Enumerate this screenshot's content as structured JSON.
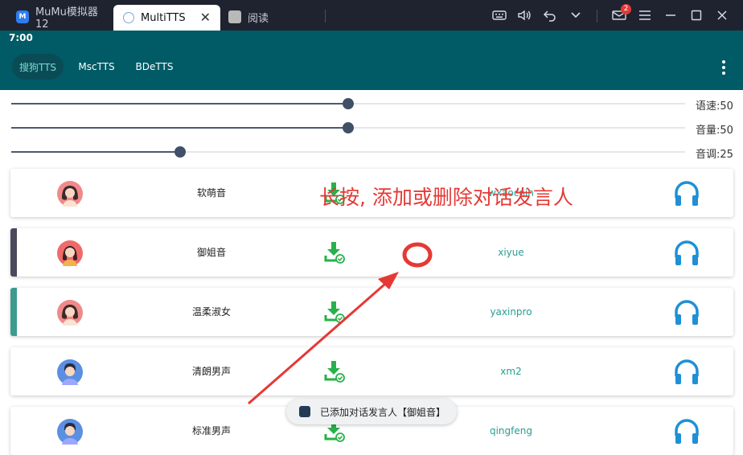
{
  "host": {
    "tabs": [
      {
        "label": "MuMu模拟器12",
        "icon": "mumu-logo-icon"
      },
      {
        "label": "MultiTTS",
        "icon": "multitts-icon"
      },
      {
        "label": "阅读",
        "icon": "reader-app-icon"
      }
    ],
    "mail_badge": "2",
    "controls": [
      "keyboard-icon",
      "volume-icon",
      "back-icon",
      "chevron-down-icon",
      "mail-icon",
      "menu-icon",
      "minimize-icon",
      "maximize-icon",
      "close-icon"
    ]
  },
  "status": {
    "time": "7:00"
  },
  "app": {
    "tabs": [
      "搜狗TTS",
      "MscTTS",
      "BDeTTS"
    ],
    "active_tab": 0
  },
  "sliders": [
    {
      "label": "语速:50",
      "value": 50,
      "max": 100
    },
    {
      "label": "音量:50",
      "value": 50,
      "max": 100
    },
    {
      "label": "音调:25",
      "value": 25,
      "max": 100
    }
  ],
  "voices": [
    {
      "name": "软萌音",
      "id": "wxaocnin",
      "gender": "female",
      "stripe": ""
    },
    {
      "name": "御姐音",
      "id": "xiyue",
      "gender": "female",
      "stripe": "#4a4a5c"
    },
    {
      "name": "温柔淑女",
      "id": "yaxinpro",
      "gender": "female",
      "stripe": "#3d9a8f"
    },
    {
      "name": "清朗男声",
      "id": "xm2",
      "gender": "male",
      "stripe": ""
    },
    {
      "name": "标准男声",
      "id": "qingfeng",
      "gender": "male",
      "stripe": ""
    }
  ],
  "annotation": {
    "text": "长按, 添加或删除对话发言人",
    "color": "#e53935"
  },
  "toast": {
    "text": "已添加对话发言人【御姐音】"
  },
  "colors": {
    "accent": "#005b66",
    "voice_id": "#2a9d8f",
    "download": "#27b14a",
    "headphone": "#1e90d6"
  }
}
